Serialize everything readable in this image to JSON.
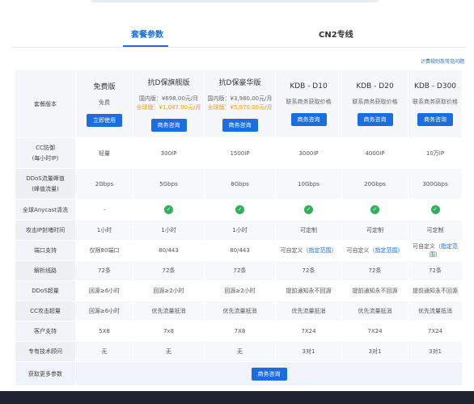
{
  "tabs": [
    {
      "label": "套餐参数",
      "active": true
    },
    {
      "label": "CN2专线",
      "active": false
    }
  ],
  "help_link": "计费规则及常见问题",
  "header": {
    "row_label": "套餐版本",
    "plans": [
      {
        "name": "免费版",
        "price_line1": "免费",
        "price_line2": "",
        "button": "立即使用"
      },
      {
        "name": "抗D保旗舰版",
        "price_line1": "国内版：¥698.00元/月",
        "price_line2": "全球版：¥1,047.00元/月",
        "button": "商务咨询"
      },
      {
        "name": "抗D保豪华版",
        "price_line1": "国内版：¥3,980.00元/月",
        "price_line2": "全球版：¥5,970.00元/月",
        "button": "商务咨询"
      },
      {
        "name": "KDB - D10",
        "price_line1": "联系商务获取价格",
        "price_line2": "",
        "button": "商务咨询"
      },
      {
        "name": "KDB - D20",
        "price_line1": "联系商务获取价格",
        "price_line2": "",
        "button": "商务咨询"
      },
      {
        "name": "KDB - D300",
        "price_line1": "联系商务获取价格",
        "price_line2": "",
        "button": "商务咨询"
      }
    ]
  },
  "rows": [
    {
      "label_line1": "CC防御",
      "label_line2": "(每小时IP)",
      "cells": [
        "轻量",
        "300IP",
        "1500IP",
        "3000IP",
        "4000IP",
        "10万IP"
      ]
    },
    {
      "label_line1": "DDoS流量峰值",
      "label_line2": "(峰值流量)",
      "cells": [
        "2Gbps",
        "5Gbps",
        "8Gbps",
        "10Gbps",
        "20Gbps",
        "300Gbps"
      ]
    },
    {
      "label_line1": "全球Anycast清洗",
      "label_line2": "",
      "cells": [
        "-",
        "check",
        "check",
        "check",
        "check",
        "check"
      ]
    },
    {
      "label_line1": "攻击IP封堵时间",
      "label_line2": "",
      "cells": [
        "1小时",
        "1小时",
        "1小时",
        "可定制",
        "可定制",
        "可定制"
      ]
    },
    {
      "label_line1": "端口支持",
      "label_line2": "",
      "cells": [
        "仅限80端口",
        "80/443",
        "80/443",
        "可自定义（指定范围）",
        "可自定义（指定范围）",
        "可自定义（指定范围）"
      ]
    },
    {
      "label_line1": "解析线路",
      "label_line2": "",
      "cells": [
        "72条",
        "72条",
        "72条",
        "72条",
        "72条",
        "72条"
      ]
    },
    {
      "label_line1": "DDoS超量",
      "label_line2": "",
      "cells": [
        "回源≥6小时",
        "回源≥2小时",
        "回源≥2小时",
        "提前通知永不回源",
        "提前通知永不回源",
        "提前通知永不回源"
      ]
    },
    {
      "label_line1": "CC攻击超量",
      "label_line2": "",
      "cells": [
        "回源≥6小时",
        "优先流量抵消",
        "优先流量抵消",
        "优先流量抵消",
        "优先流量抵消",
        "优先流量抵消"
      ]
    },
    {
      "label_line1": "客户支持",
      "label_line2": "",
      "cells": [
        "5X8",
        "7x8",
        "7X8",
        "7X24",
        "7X24",
        "7X24"
      ]
    },
    {
      "label_line1": "专有技术顾问",
      "label_line2": "",
      "cells": [
        "无",
        "无",
        "无",
        "3对1",
        "3对1",
        "3对1"
      ]
    }
  ],
  "footer": {
    "label": "获取更多参数",
    "button": "商务咨询"
  },
  "icons": {
    "check": "check-circle-icon"
  },
  "colors": {
    "accent": "#1c6de0",
    "intl_price": "#f59a23",
    "check": "#2fb15a"
  }
}
